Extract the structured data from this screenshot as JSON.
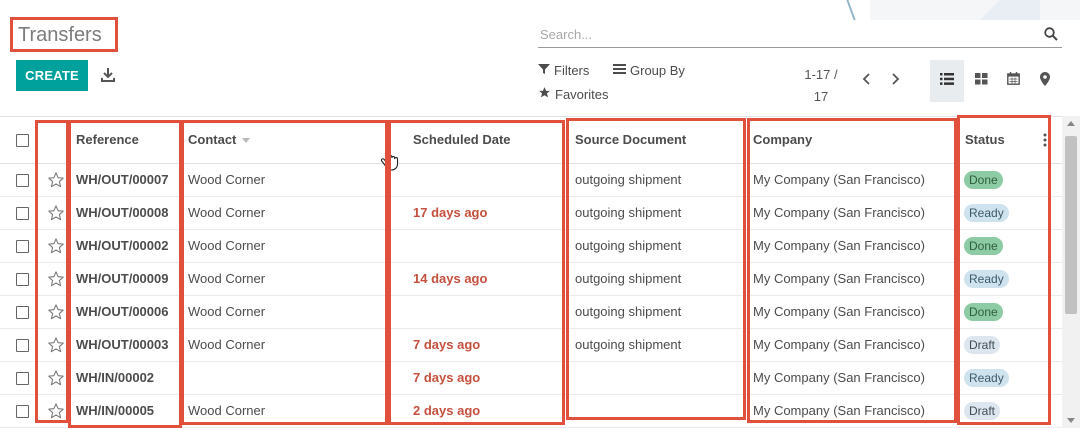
{
  "header": {
    "title": "Transfers",
    "create_label": "CREATE"
  },
  "search": {
    "placeholder": "Search..."
  },
  "controls": {
    "filters_label": "Filters",
    "groupby_label": "Group By",
    "favorites_label": "Favorites"
  },
  "pager": {
    "range": "1-17 /",
    "total": "17"
  },
  "views": [
    "list",
    "kanban",
    "calendar",
    "map"
  ],
  "active_view": "list",
  "table": {
    "columns": [
      "Reference",
      "Contact",
      "Scheduled Date",
      "Source Document",
      "Company",
      "Status"
    ],
    "rows": [
      {
        "reference": "WH/OUT/00007",
        "contact": "Wood Corner",
        "scheduled": "",
        "source": "outgoing shipment",
        "company": "My Company (San Francisco)",
        "status": "Done"
      },
      {
        "reference": "WH/OUT/00008",
        "contact": "Wood Corner",
        "scheduled": "17 days ago",
        "source": "outgoing shipment",
        "company": "My Company (San Francisco)",
        "status": "Ready"
      },
      {
        "reference": "WH/OUT/00002",
        "contact": "Wood Corner",
        "scheduled": "",
        "source": "outgoing shipment",
        "company": "My Company (San Francisco)",
        "status": "Done"
      },
      {
        "reference": "WH/OUT/00009",
        "contact": "Wood Corner",
        "scheduled": "14 days ago",
        "source": "outgoing shipment",
        "company": "My Company (San Francisco)",
        "status": "Ready"
      },
      {
        "reference": "WH/OUT/00006",
        "contact": "Wood Corner",
        "scheduled": "",
        "source": "outgoing shipment",
        "company": "My Company (San Francisco)",
        "status": "Done"
      },
      {
        "reference": "WH/OUT/00003",
        "contact": "Wood Corner",
        "scheduled": "7 days ago",
        "source": "outgoing shipment",
        "company": "My Company (San Francisco)",
        "status": "Draft"
      },
      {
        "reference": "WH/IN/00002",
        "contact": "",
        "scheduled": "7 days ago",
        "source": "",
        "company": "My Company (San Francisco)",
        "status": "Ready"
      },
      {
        "reference": "WH/IN/00005",
        "contact": "Wood Corner",
        "scheduled": "2 days ago",
        "source": "",
        "company": "My Company (San Francisco)",
        "status": "Draft"
      }
    ]
  },
  "colors": {
    "primary": "#00a09d",
    "late_date": "#c4503d",
    "badge_done": "#8ccba3",
    "badge_ready": "#cfe3ef",
    "badge_draft": "#dde6ee",
    "annotation": "#e0503c"
  }
}
